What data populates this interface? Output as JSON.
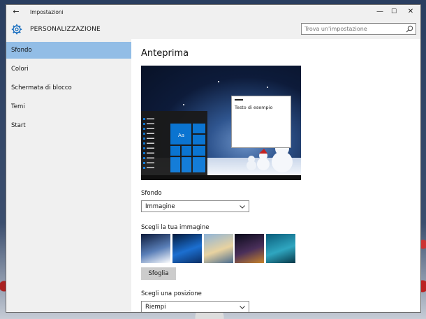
{
  "window": {
    "title": "Impostazioni",
    "back_icon": "←",
    "minimize_icon": "—",
    "maximize_icon": "☐",
    "close_icon": "✕"
  },
  "header": {
    "title": "PERSONALIZZAZIONE",
    "search_placeholder": "Trova un'impostazione"
  },
  "sidebar": {
    "items": [
      {
        "label": "Sfondo",
        "selected": true
      },
      {
        "label": "Colori",
        "selected": false
      },
      {
        "label": "Schermata di blocco",
        "selected": false
      },
      {
        "label": "Temi",
        "selected": false
      },
      {
        "label": "Start",
        "selected": false
      }
    ]
  },
  "main": {
    "heading": "Anteprima",
    "preview": {
      "tile_text": "Aa",
      "sample_text": "Testo di esempio"
    },
    "background_label": "Sfondo",
    "background_value": "Immagine",
    "choose_image_label": "Scegli la tua immagine",
    "thumbnails": [
      {
        "name": "snowmen-thumbnail",
        "colors": [
          "#0c1a3a",
          "#5a7fb8",
          "#ffffff"
        ]
      },
      {
        "name": "windows-thumbnail",
        "colors": [
          "#031a3c",
          "#1c6fd0",
          "#0b2f66"
        ]
      },
      {
        "name": "beach-rocks-thumbnail",
        "colors": [
          "#8fb4d8",
          "#e8d2a0",
          "#4b6c8f"
        ]
      },
      {
        "name": "night-sky-thumbnail",
        "colors": [
          "#0a0a1a",
          "#4a2f5a",
          "#c8842a"
        ]
      },
      {
        "name": "underwater-thumbnail",
        "colors": [
          "#0a5c7a",
          "#2fa6c0",
          "#073848"
        ]
      }
    ],
    "browse_label": "Sfoglia",
    "position_label": "Scegli una posizione",
    "position_value": "Riempi"
  },
  "colors": {
    "accent": "#0a78d7",
    "selection": "#92bde6"
  }
}
